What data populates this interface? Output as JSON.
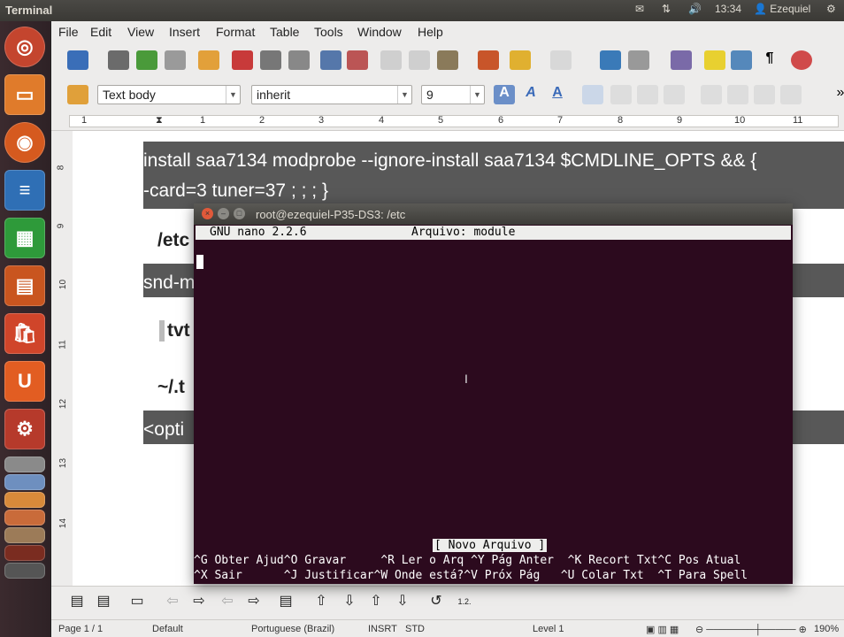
{
  "topbar": {
    "app": "Terminal",
    "time": "13:34",
    "user": "Ezequiel"
  },
  "menu": [
    "File",
    "Edit",
    "View",
    "Insert",
    "Format",
    "Table",
    "Tools",
    "Window",
    "Help"
  ],
  "format": {
    "style": "Text body",
    "font": "inherit",
    "size": "9"
  },
  "ruler_ticks": [
    "1",
    "1",
    "2",
    "3",
    "4",
    "5",
    "6",
    "7",
    "8",
    "9",
    "10",
    "11"
  ],
  "vruler_ticks": [
    "8",
    "9",
    "10",
    "11",
    "12",
    "13",
    "14"
  ],
  "document": {
    "line1": "install saa7134 modprobe --ignore-install saa7134 $CMDLINE_OPTS && {",
    "line2": "-card=3 tuner=37 ; ; ; }",
    "frag_etc": "/etc",
    "frag_snd": "snd-m",
    "frag_tvt": "tvt",
    "frag_home": "~/.t",
    "frag_opt": "<opti"
  },
  "terminal": {
    "title": "root@ezequiel-P35-DS3: /etc",
    "nano_version": "GNU nano 2.2.6",
    "nano_file": "Arquivo: module",
    "status_msg": "[ Novo Arquivo ]",
    "shortcuts_row1": "^G Obter Ajud^O Gravar     ^R Ler o Arq ^Y Pág Anter  ^K Recort Txt^C Pos Atual",
    "shortcuts_row2": "^X Sair      ^J Justificar^W Onde está?^V Próx Pág   ^U Colar Txt  ^T Para Spell"
  },
  "status": {
    "page": "Page 1 / 1",
    "style": "Default",
    "lang": "Portuguese (Brazil)",
    "insert": "INSRT",
    "sel": "STD",
    "level": "Level 1",
    "zoom": "190%"
  }
}
